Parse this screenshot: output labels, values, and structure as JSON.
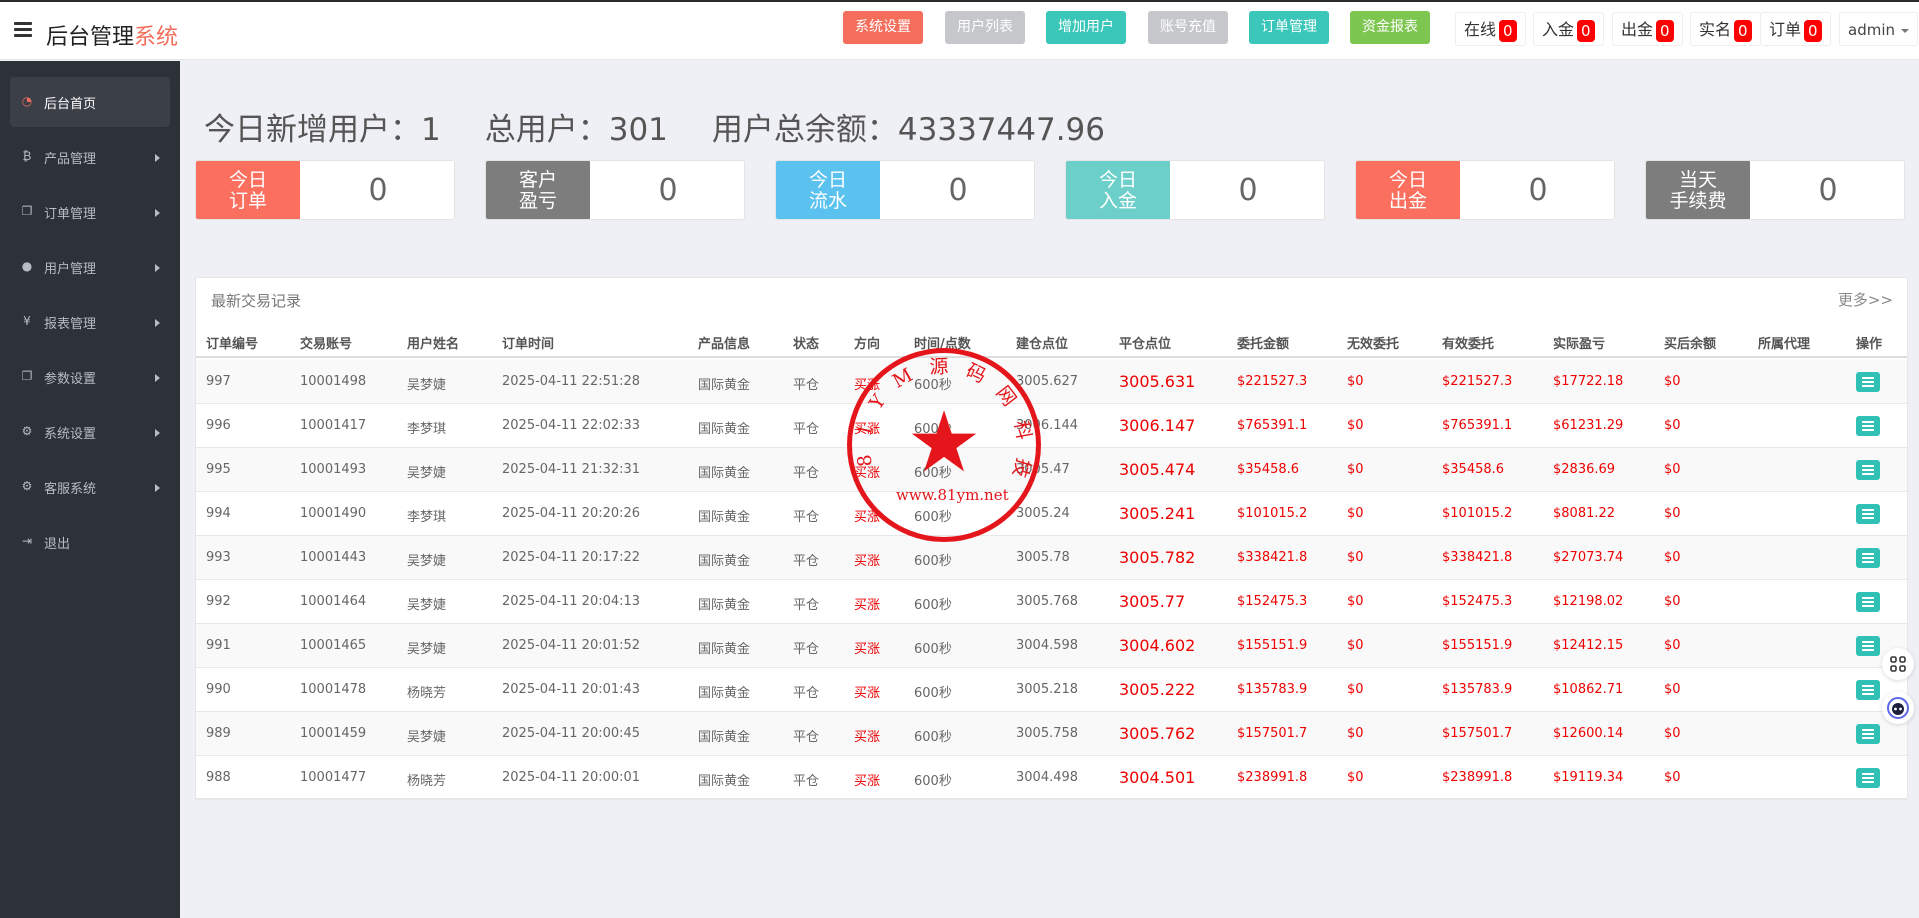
{
  "header": {
    "brand_main": "后台管理",
    "brand_accent": "系统",
    "nav_buttons": [
      {
        "label": "系统设置",
        "color": "#f46e5b"
      },
      {
        "label": "用户列表",
        "color": "#c5c7cb"
      },
      {
        "label": "增加用户",
        "color": "#3ac6b9"
      },
      {
        "label": "账号充值",
        "color": "#c5c7cb"
      },
      {
        "label": "订单管理",
        "color": "#3ac6b9"
      },
      {
        "label": "资金报表",
        "color": "#7dc650"
      }
    ],
    "stats": [
      {
        "label": "在线",
        "count": "0"
      },
      {
        "label": "入金",
        "count": "0"
      },
      {
        "label": "出金",
        "count": "0"
      },
      {
        "label": "实名",
        "count": "0"
      },
      {
        "label": "订单",
        "count": "0"
      }
    ],
    "user": "admin"
  },
  "sidebar": {
    "items": [
      {
        "label": "后台首页",
        "icon": "dashboard-icon"
      },
      {
        "label": "产品管理",
        "icon": "bitcoin-icon"
      },
      {
        "label": "订单管理",
        "icon": "copy-icon"
      },
      {
        "label": "用户管理",
        "icon": "user-icon"
      },
      {
        "label": "报表管理",
        "icon": "yen-icon"
      },
      {
        "label": "参数设置",
        "icon": "copy-icon"
      },
      {
        "label": "系统设置",
        "icon": "gears-icon"
      },
      {
        "label": "客服系统",
        "icon": "gears-icon"
      },
      {
        "label": "退出",
        "icon": "sign-out-icon"
      }
    ]
  },
  "summary": {
    "new_users": "今日新增用户：1",
    "total_users": "总用户：301",
    "total_balance": "用户总余额：43337447.96"
  },
  "kpis": [
    {
      "line1": "今日",
      "line2": "订单",
      "value": "0",
      "color": "#fb6f5e"
    },
    {
      "line1": "客户",
      "line2": "盈亏",
      "value": "0",
      "color": "#7d7d7d"
    },
    {
      "line1": "今日",
      "line2": "流水",
      "value": "0",
      "color": "#5bc2f0"
    },
    {
      "line1": "今日",
      "line2": "入金",
      "value": "0",
      "color": "#6ccfca"
    },
    {
      "line1": "今日",
      "line2": "出金",
      "value": "0",
      "color": "#fb6f5e"
    },
    {
      "line1": "当天",
      "line2": "手续费",
      "value": "0",
      "color": "#7d7d7d"
    }
  ],
  "trades": {
    "title": "最新交易记录",
    "more": "更多>>",
    "columns": [
      "订单编号",
      "交易账号",
      "用户姓名",
      "订单时间",
      "产品信息",
      "状态",
      "方向",
      "时间/点数",
      "建仓点位",
      "平仓点位",
      "委托金额",
      "无效委托",
      "有效委托",
      "实际盈亏",
      "买后余额",
      "所属代理",
      "操作"
    ],
    "rows": [
      [
        "997",
        "10001498",
        "吴梦婕",
        "2025-04-11 22:51:28",
        "国际黄金",
        "平仓",
        "买涨",
        "600秒",
        "3005.627",
        "3005.631",
        "$221527.3",
        "$0",
        "$221527.3",
        "$17722.18",
        "$0",
        ""
      ],
      [
        "996",
        "10001417",
        "李梦琪",
        "2025-04-11 22:02:33",
        "国际黄金",
        "平仓",
        "买涨",
        "600秒",
        "3006.144",
        "3006.147",
        "$765391.1",
        "$0",
        "$765391.1",
        "$61231.29",
        "$0",
        ""
      ],
      [
        "995",
        "10001493",
        "吴梦婕",
        "2025-04-11 21:32:31",
        "国际黄金",
        "平仓",
        "买涨",
        "600秒",
        "3005.47",
        "3005.474",
        "$35458.6",
        "$0",
        "$35458.6",
        "$2836.69",
        "$0",
        ""
      ],
      [
        "994",
        "10001490",
        "李梦琪",
        "2025-04-11 20:20:26",
        "国际黄金",
        "平仓",
        "买涨",
        "600秒",
        "3005.24",
        "3005.241",
        "$101015.2",
        "$0",
        "$101015.2",
        "$8081.22",
        "$0",
        ""
      ],
      [
        "993",
        "10001443",
        "吴梦婕",
        "2025-04-11 20:17:22",
        "国际黄金",
        "平仓",
        "买涨",
        "600秒",
        "3005.78",
        "3005.782",
        "$338421.8",
        "$0",
        "$338421.8",
        "$27073.74",
        "$0",
        ""
      ],
      [
        "992",
        "10001464",
        "吴梦婕",
        "2025-04-11 20:04:13",
        "国际黄金",
        "平仓",
        "买涨",
        "600秒",
        "3005.768",
        "3005.77",
        "$152475.3",
        "$0",
        "$152475.3",
        "$12198.02",
        "$0",
        ""
      ],
      [
        "991",
        "10001465",
        "吴梦婕",
        "2025-04-11 20:01:52",
        "国际黄金",
        "平仓",
        "买涨",
        "600秒",
        "3004.598",
        "3004.602",
        "$155151.9",
        "$0",
        "$155151.9",
        "$12412.15",
        "$0",
        ""
      ],
      [
        "990",
        "10001478",
        "杨晓芳",
        "2025-04-11 20:01:43",
        "国际黄金",
        "平仓",
        "买涨",
        "600秒",
        "3005.218",
        "3005.222",
        "$135783.9",
        "$0",
        "$135783.9",
        "$10862.71",
        "$0",
        ""
      ],
      [
        "989",
        "10001459",
        "吴梦婕",
        "2025-04-11 20:00:45",
        "国际黄金",
        "平仓",
        "买涨",
        "600秒",
        "3005.758",
        "3005.762",
        "$157501.7",
        "$0",
        "$157501.7",
        "$12600.14",
        "$0",
        ""
      ],
      [
        "988",
        "10001477",
        "杨晓芳",
        "2025-04-11 20:00:01",
        "国际黄金",
        "平仓",
        "买涨",
        "600秒",
        "3004.498",
        "3004.501",
        "$238991.8",
        "$0",
        "$238991.8",
        "$19119.34",
        "$0",
        ""
      ]
    ]
  },
  "stamp": {
    "arc_text": "8 1 Y M 源 码 网 科 技",
    "url": "www.81ym.net",
    "color": "#e4161b"
  }
}
